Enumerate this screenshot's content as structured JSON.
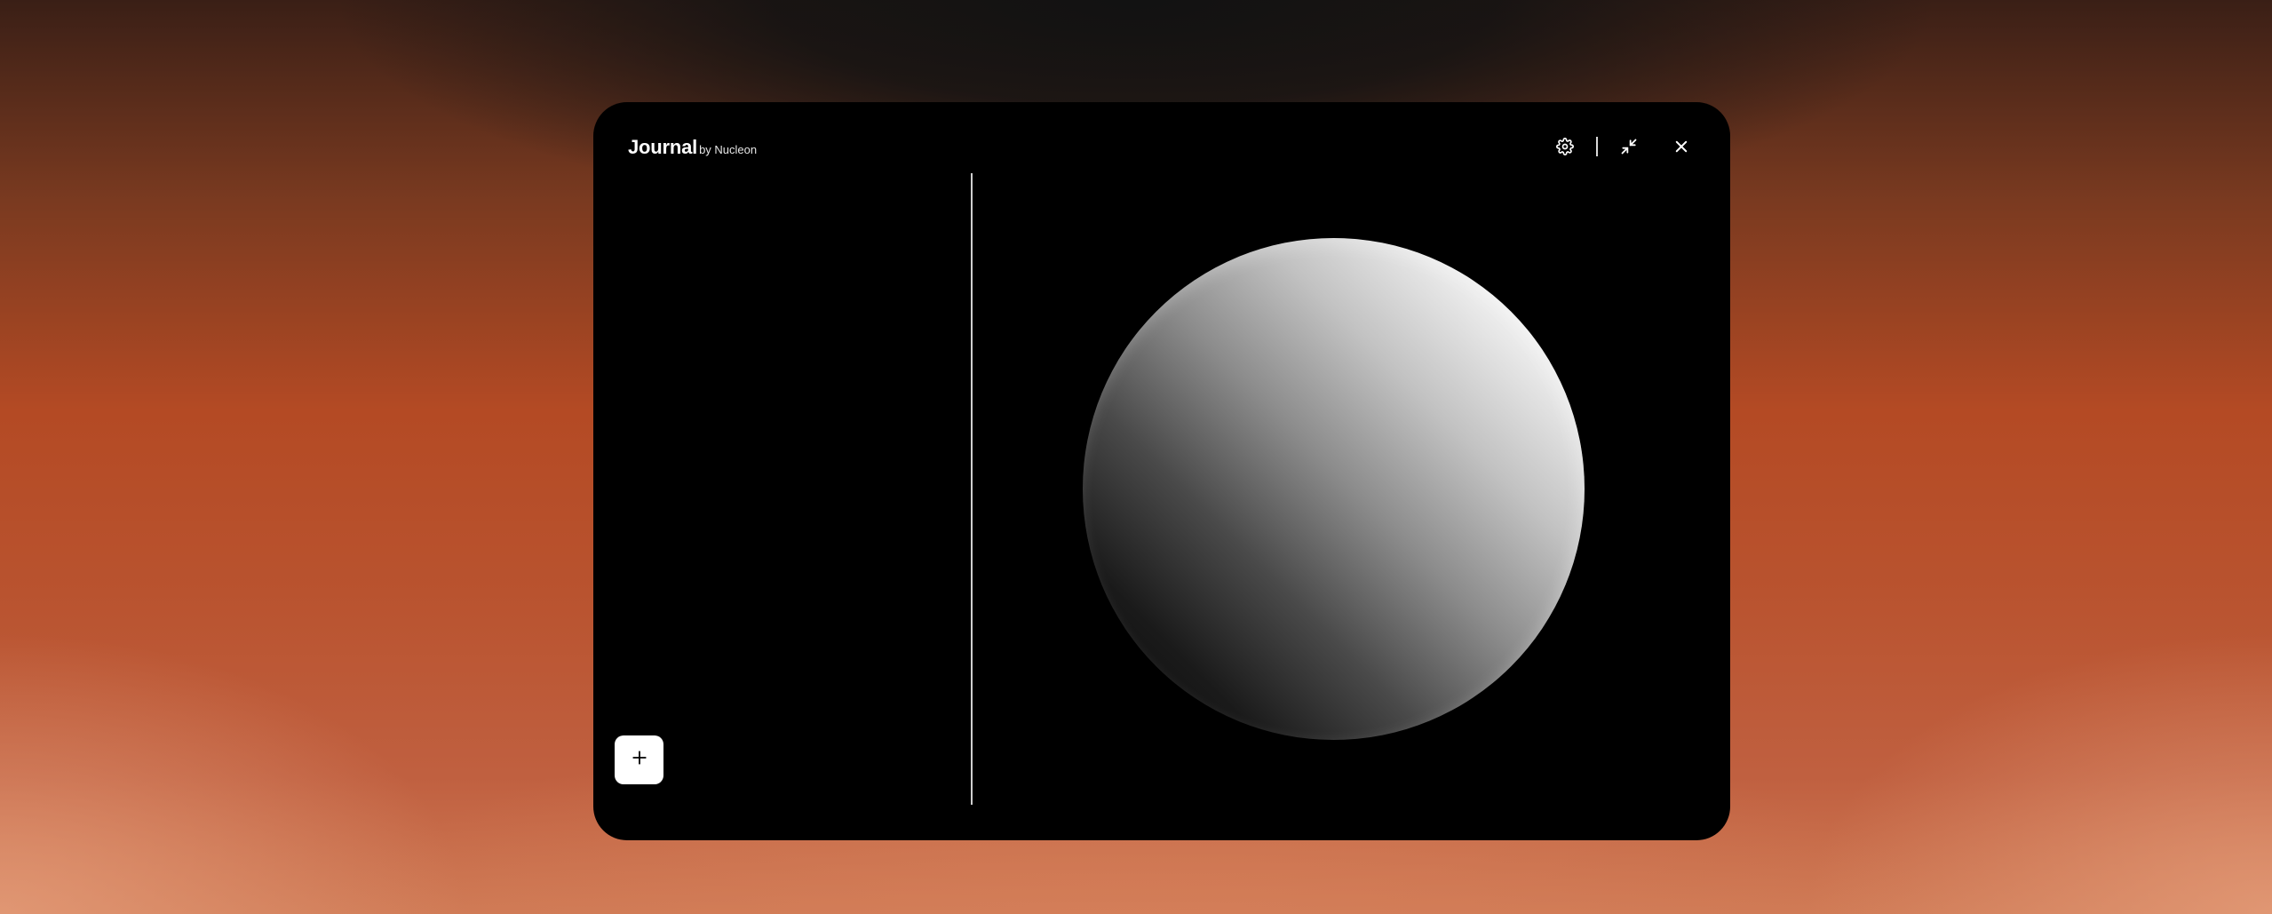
{
  "app": {
    "name": "Journal",
    "byline": "by Nucleon"
  },
  "controls": {
    "settings": "gear-icon",
    "minimize": "collapse-icon",
    "close": "close-icon"
  },
  "sidebar": {
    "add_icon": "plus-icon"
  },
  "colors": {
    "window_bg": "#000000",
    "accent": "#b44a24",
    "text": "#ffffff"
  }
}
